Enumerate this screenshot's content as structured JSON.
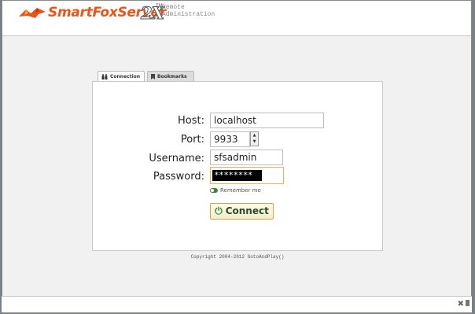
{
  "app": {
    "logo_name": "SmartFoxServer",
    "logo_version": "2X",
    "logo_tm": "TM",
    "logo_sub_1": "Remote",
    "logo_sub_2": "Administration"
  },
  "tabs": [
    {
      "label": "Connection",
      "active": true
    },
    {
      "label": "Bookmarks",
      "active": false
    }
  ],
  "form": {
    "host_label": "Host:",
    "host_value": "localhost",
    "port_label": "Port:",
    "port_value": "9933",
    "username_label": "Username:",
    "username_value": "sfsadmin",
    "password_label": "Password:",
    "password_mask": "********",
    "remember_label": "Remember me",
    "connect_label": "Connect"
  },
  "footer": {
    "copyright": "Copyright 2004-2012 GotoAndPlay()"
  },
  "colors": {
    "brand": "#e8541a",
    "accent": "#d4a840",
    "toggle_on": "#3a8a2c"
  }
}
